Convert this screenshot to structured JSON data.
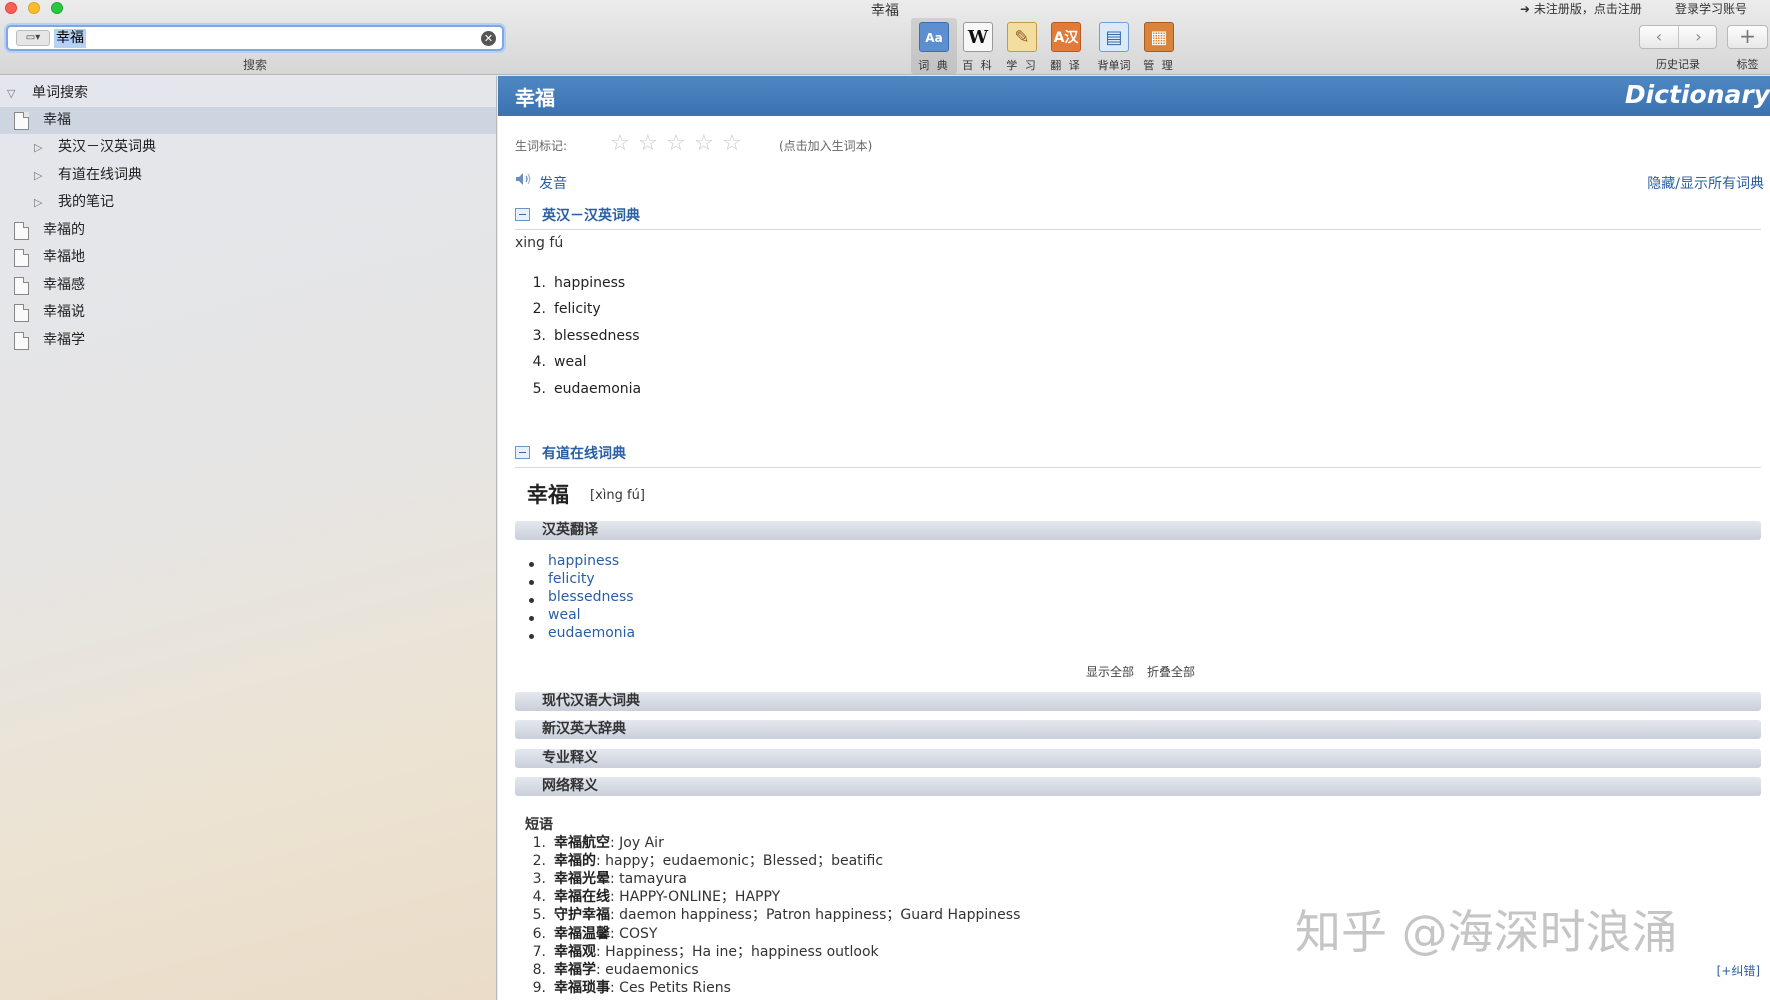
{
  "window": {
    "title": "幸福"
  },
  "search": {
    "scope_label": "▭▾",
    "value": "幸福",
    "clear_icon": "clear-icon",
    "caption": "搜索"
  },
  "toolbar": {
    "tools": [
      {
        "label": "词 典",
        "icon": "dictionary-icon",
        "glyph": "Aa",
        "color": "#5b8fcf"
      },
      {
        "label": "百 科",
        "icon": "wikipedia-icon",
        "glyph": "W",
        "color": "#f2f2f2"
      },
      {
        "label": "学 习",
        "icon": "notebook-icon",
        "glyph": "✎",
        "color": "#e8c46a"
      },
      {
        "label": "翻 译",
        "icon": "translate-icon",
        "glyph": "译",
        "color": "#e27a3a"
      },
      {
        "label": "背单词",
        "icon": "flashcard-book-icon",
        "glyph": "▤",
        "color": "#6e9ed6"
      },
      {
        "label": "管 理",
        "icon": "cabinet-icon",
        "glyph": "▦",
        "color": "#d9843c"
      }
    ],
    "history_caption": "历史记录",
    "tag_caption": "标签",
    "register_text": "➜ 未注册版，点击注册",
    "login_text": "登录学习账号"
  },
  "sidebar": {
    "root_label": "单词搜索",
    "selected_word": "幸福",
    "sub_items": [
      "英汉－汉英词典",
      "有道在线词典",
      "我的笔记"
    ],
    "other_words": [
      "幸福的",
      "幸福地",
      "幸福感",
      "幸福说",
      "幸福学"
    ]
  },
  "main": {
    "word": "幸福",
    "brand": "Dictionary",
    "rating_label": "生词标记:",
    "rating_stars": 0,
    "rating_hint": "(点击加入生词本)",
    "pronounce": "发音",
    "toggle_all": "隐藏/显示所有词典",
    "sections": {
      "ec": {
        "title": "英汉－汉英词典",
        "pinyin": "xing fú",
        "definitions": [
          "happiness",
          "felicity",
          "blessedness",
          "weal",
          "eudaemonia"
        ]
      },
      "youdao": {
        "title": "有道在线词典",
        "word": "幸福",
        "pinyin": "[xìng fú]",
        "translation_header": "汉英翻译",
        "translations": [
          "happiness",
          "felicity",
          "blessedness",
          "weal",
          "eudaemonia"
        ],
        "show_all": "显示全部",
        "collapse_all": "折叠全部",
        "bars": [
          "现代汉语大词典",
          "新汉英大辞典",
          "专业释义",
          "网络释义"
        ],
        "phrase_label": "短语",
        "phrases": [
          {
            "term": "幸福航空",
            "meaning": ": Joy Air"
          },
          {
            "term": "幸福的",
            "meaning": ": happy；eudaemonic；Blessed；beatific"
          },
          {
            "term": "幸福光晕",
            "meaning": ": tamayura"
          },
          {
            "term": "幸福在线",
            "meaning": ": HAPPY-ONLINE；HAPPY"
          },
          {
            "term": "守护幸福",
            "meaning": ": daemon happiness；Patron happiness；Guard Happiness"
          },
          {
            "term": "幸福温馨",
            "meaning": ": COSY"
          },
          {
            "term": "幸福观",
            "meaning": ": Happiness；Ha ine；happiness outlook"
          },
          {
            "term": "幸福学",
            "meaning": ": eudaemonics"
          },
          {
            "term": "幸福琐事",
            "meaning": ": Ces Petits Riens"
          }
        ],
        "correct_link": "[+纠错]"
      }
    }
  },
  "watermark": "知乎 @海深时浪涌"
}
